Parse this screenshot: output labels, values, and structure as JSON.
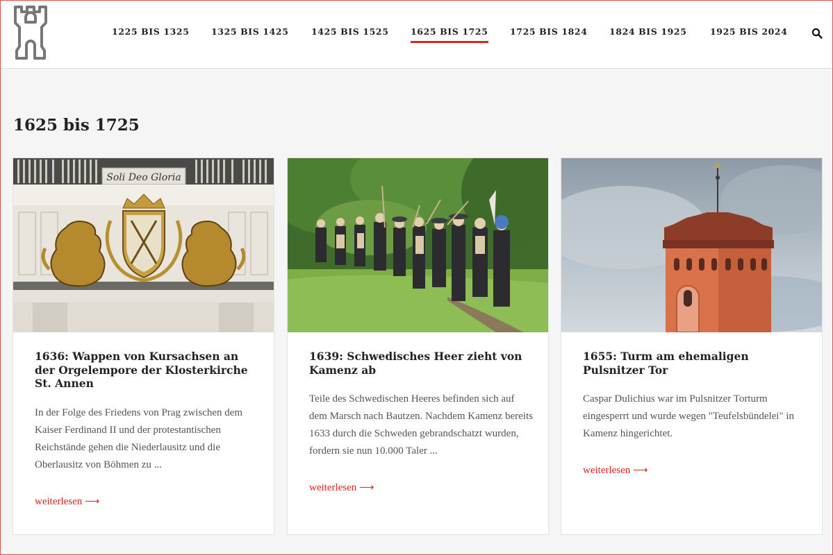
{
  "nav": {
    "items": [
      "1225 BIS 1325",
      "1325 BIS 1425",
      "1425 BIS 1525",
      "1625 BIS 1725",
      "1725 BIS 1824",
      "1824 BIS 1925",
      "1925 BIS 2024"
    ],
    "active_index": 3,
    "logo_icon": "castle-tower-icon",
    "search_icon": "search-icon"
  },
  "page": {
    "title": "1625 bis 1725"
  },
  "cards": [
    {
      "title": "1636: Wappen von Kursachsen an der Orgelempore der Klosterkirche St. Annen",
      "excerpt": "In der Folge des Friedens von Prag zwischen dem Kaiser Ferdinand II und der protestantischen Reichstände gehen die Niederlausitz und die Oberlausitz von Böhmen zu ...",
      "more": "weiterlesen ⟶",
      "image_text": "Soli Deo Gloria"
    },
    {
      "title": "1639: Schwedisches Heer zieht von Kamenz ab",
      "excerpt": "Teile des Schwedischen Heeres befinden sich auf dem Marsch nach Bautzen. Nachdem Kamenz bereits 1633 durch die Schweden gebrandschatzt wurden, fordern sie nun 10.000 Taler ...",
      "more": "weiterlesen ⟶"
    },
    {
      "title": "1655: Turm am ehemaligen Pulsnitzer Tor",
      "excerpt": "Caspar Dulichius war im Pulsnitzer Torturm eingesperrt und wurde wegen \"Teufelsbündelei\" in Kamenz hingerichtet.",
      "more": "weiterlesen ⟶"
    }
  ],
  "colors": {
    "accent": "#e0251b",
    "text": "#222222",
    "muted": "#555555",
    "background": "#f5f5f5"
  }
}
